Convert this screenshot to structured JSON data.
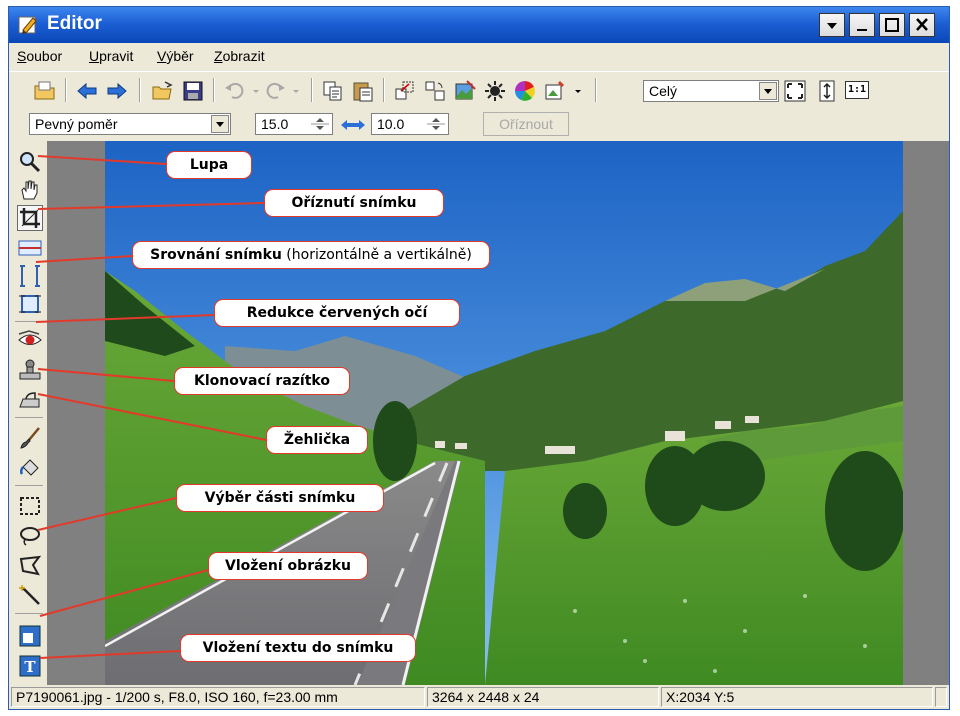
{
  "window": {
    "title": "Editor"
  },
  "menu": {
    "items": [
      "Soubor",
      "Upravit",
      "Výběr",
      "Zobrazit"
    ]
  },
  "toolbar": {
    "view_select": "Celý",
    "zoom_fit_label": "1:1"
  },
  "crop_toolbar": {
    "ratio_select": "Pevný poměr",
    "width_value": "15.0",
    "height_value": "10.0",
    "crop_button": "Oříznout"
  },
  "status": {
    "file_info": "P7190061.jpg - 1/200 s, F8.0, ISO 160, f=23.00 mm",
    "dimensions": "3264 x 2448 x 24",
    "coords": "X:2034  Y:5"
  },
  "callouts": {
    "lupa": "Lupa",
    "crop": "Oříznutí snímku",
    "align_bold": "Srovnání snímku",
    "align_normal": " (horizontálně a vertikálně)",
    "redeye": "Redukce červených očí",
    "clone": "Klonovací razítko",
    "iron": "Žehlička",
    "selection": "Výběr části snímku",
    "insert_image": "Vložení obrázku",
    "insert_text": "Vložení textu do snímku"
  },
  "colors": {
    "callout_border": "#e23a2a",
    "title_bar": "#1c5fd4"
  }
}
